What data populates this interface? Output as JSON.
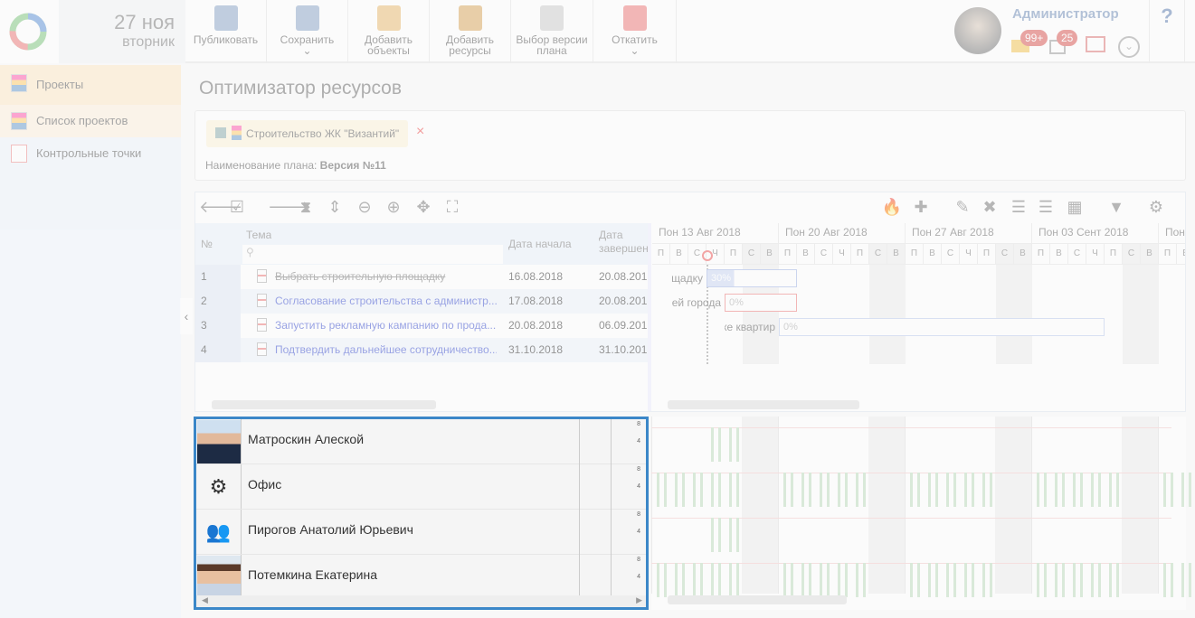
{
  "header": {
    "date": "27 ноя",
    "weekday": "вторник",
    "toolbar": [
      {
        "label": "Публиковать",
        "icon": "publish-icon"
      },
      {
        "label": "Сохранить",
        "icon": "save-icon",
        "dropdown": true
      },
      {
        "label": "Добавить объекты",
        "icon": "add-objects-icon"
      },
      {
        "label": "Добавить ресурсы",
        "icon": "add-resources-icon"
      },
      {
        "label": "Выбор версии плана",
        "icon": "plan-version-icon"
      },
      {
        "label": "Откатить",
        "icon": "rollback-icon",
        "dropdown": true
      }
    ],
    "user": {
      "name": "Администратор",
      "mail_badge": "99+",
      "tasks_badge": "25"
    },
    "help": "?"
  },
  "sidebar": {
    "items": [
      {
        "label": "Проекты"
      },
      {
        "label": "Список проектов"
      },
      {
        "label": "Контрольные точки"
      }
    ]
  },
  "page": {
    "title": "Оптимизатор ресурсов",
    "project_chip": "Строительство ЖК \"Византий\"",
    "remove": "×",
    "plan_label": "Наименование плана:",
    "plan_value": "Версия №11"
  },
  "grid": {
    "columns": {
      "num": "№",
      "topic": "Тема",
      "start": "Дата начала",
      "end": "Дата завершен"
    },
    "rows": [
      {
        "num": "1",
        "topic": "Выбрать строительную площадку",
        "start": "16.08.2018",
        "end": "20.08.201",
        "done": true,
        "bar_label": "щадку",
        "progress": "30%"
      },
      {
        "num": "2",
        "topic": "Согласование строительства с администр...",
        "start": "17.08.2018",
        "end": "20.08.201",
        "bar_label": "ей города",
        "progress": "0%"
      },
      {
        "num": "3",
        "topic": "Запустить рекламную кампанию по прода...",
        "start": "20.08.2018",
        "end": "06.09.201",
        "bar_label": "по продаже квартир",
        "progress": "0%"
      },
      {
        "num": "4",
        "topic": "Подтвердить дальнейшее сотрудничество...",
        "start": "31.10.2018",
        "end": "31.10.201"
      }
    ]
  },
  "timeline": {
    "weeks": [
      "Пон 13 Авг 2018",
      "Пон 20 Авг 2018",
      "Пон 27 Авг 2018",
      "Пон 03 Сент 2018",
      "Пон"
    ],
    "days": [
      "П",
      "В",
      "С",
      "Ч",
      "П",
      "С",
      "В"
    ]
  },
  "resources": [
    {
      "name": "Матроскин Алеской",
      "type": "photo-man"
    },
    {
      "name": "Офис",
      "type": "gear"
    },
    {
      "name": "Пирогов Анатолий Юрьевич",
      "type": "users"
    },
    {
      "name": "Потемкина Екатерина",
      "type": "photo-woman"
    }
  ],
  "axis": {
    "high": "8",
    "low": "4"
  }
}
